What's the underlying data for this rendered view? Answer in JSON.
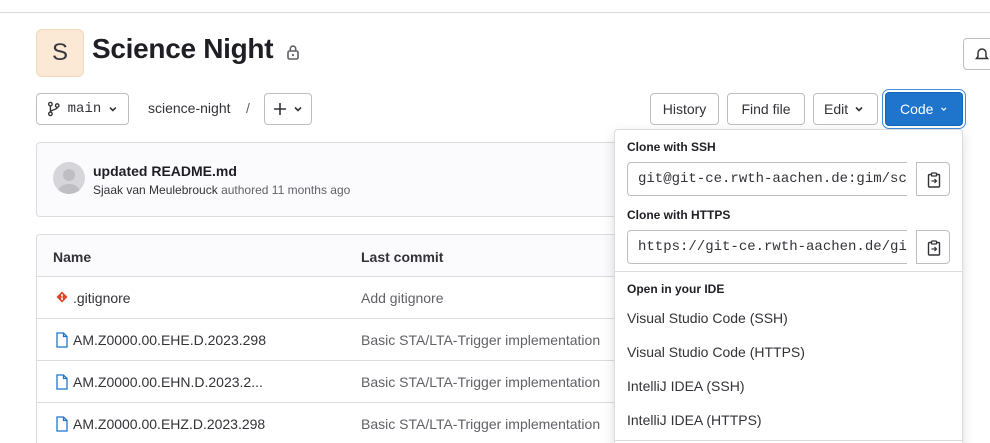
{
  "project": {
    "avatar_letter": "S",
    "title": "Science Night"
  },
  "toolbar": {
    "branch": "main",
    "path": "science-night",
    "path_separator": "/",
    "history_label": "History",
    "find_file_label": "Find file",
    "edit_label": "Edit",
    "code_label": "Code"
  },
  "last_commit": {
    "message": "updated README.md",
    "author": "Sjaak van Meulebrouck",
    "action": "authored",
    "time": "11 months ago"
  },
  "file_table": {
    "headers": {
      "name": "Name",
      "last_commit": "Last commit"
    },
    "rows": [
      {
        "name": ".gitignore",
        "icon": "git-icon",
        "last_commit": "Add gitignore"
      },
      {
        "name": "AM.Z0000.00.EHE.D.2023.298",
        "icon": "file-icon",
        "last_commit": "Basic STA/LTA-Trigger implementation"
      },
      {
        "name": "AM.Z0000.00.EHN.D.2023.2...",
        "icon": "file-icon",
        "last_commit": "Basic STA/LTA-Trigger implementation"
      },
      {
        "name": "AM.Z0000.00.EHZ.D.2023.298",
        "icon": "file-icon",
        "last_commit": "Basic STA/LTA-Trigger implementation"
      }
    ]
  },
  "code_dropdown": {
    "ssh_heading": "Clone with SSH",
    "ssh_url": "git@git-ce.rwth-aachen.de:gim/sc",
    "https_heading": "Clone with HTTPS",
    "https_url": "https://git-ce.rwth-aachen.de/gi",
    "ide_heading": "Open in your IDE",
    "ide_items": [
      "Visual Studio Code (SSH)",
      "Visual Studio Code (HTTPS)",
      "IntelliJ IDEA (SSH)",
      "IntelliJ IDEA (HTTPS)"
    ]
  },
  "colors": {
    "primary": "#1f75cb",
    "git_icon": "#e24329",
    "file_icon": "#1f75cb"
  }
}
